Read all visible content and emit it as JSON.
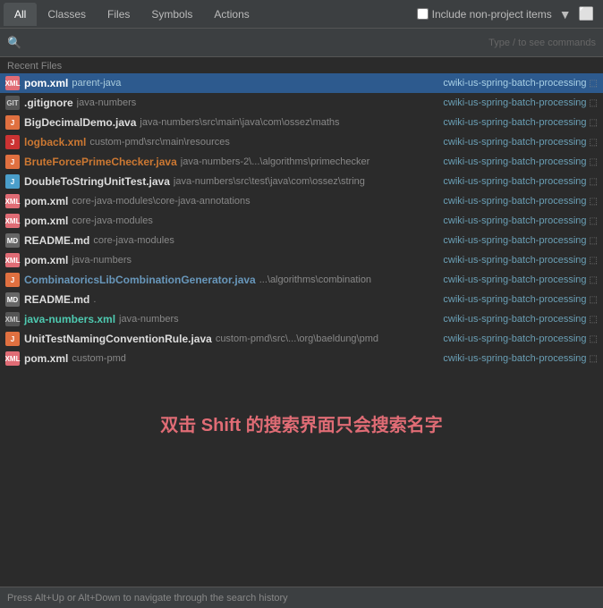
{
  "tabs": [
    {
      "id": "all",
      "label": "All",
      "active": true
    },
    {
      "id": "classes",
      "label": "Classes",
      "active": false
    },
    {
      "id": "files",
      "label": "Files",
      "active": false
    },
    {
      "id": "symbols",
      "label": "Symbols",
      "active": false
    },
    {
      "id": "actions",
      "label": "Actions",
      "active": false
    }
  ],
  "header": {
    "checkbox_label": "Include non-project items",
    "filter_icon": "☰",
    "layout_icon": "⬜"
  },
  "search": {
    "placeholder": "",
    "hint": "Type / to see commands"
  },
  "section_label": "Recent Files",
  "files": [
    {
      "icon_type": "xml",
      "icon_text": "XML",
      "name": "pom.xml",
      "name_color": "selected-white",
      "extra": "parent-java",
      "extra_color": "white",
      "path": "",
      "project": "cwiki-us-spring-batch-processing",
      "selected": true
    },
    {
      "icon_type": "gitignore",
      "icon_text": "GIT",
      "name": ".gitignore",
      "name_color": "white",
      "extra": "java-numbers",
      "extra_color": "",
      "path": "",
      "project": "cwiki-us-spring-batch-processing",
      "selected": false
    },
    {
      "icon_type": "java-orange",
      "icon_text": "J",
      "name": "BigDecimalDemo.java",
      "name_color": "white",
      "extra": "",
      "extra_color": "",
      "path": "java-numbers\\src\\main\\java\\com\\ossez\\maths",
      "project": "cwiki-us-spring-batch-processing",
      "selected": false
    },
    {
      "icon_type": "java-red",
      "icon_text": "J",
      "name": "logback.xml",
      "name_color": "orange",
      "extra": "",
      "extra_color": "",
      "path": "custom-pmd\\src\\main\\resources",
      "project": "cwiki-us-spring-batch-processing",
      "selected": false
    },
    {
      "icon_type": "java-orange",
      "icon_text": "J",
      "name": "BruteForcePrimeChecker.java",
      "name_color": "orange",
      "extra": "",
      "extra_color": "",
      "path": "java-numbers-2\\...\\algorithms\\primechecker",
      "project": "cwiki-us-spring-batch-processing",
      "selected": false
    },
    {
      "icon_type": "java-blue",
      "icon_text": "J",
      "name": "DoubleToStringUnitTest.java",
      "name_color": "white",
      "extra": "",
      "extra_color": "",
      "path": "java-numbers\\src\\test\\java\\com\\ossez\\string",
      "project": "cwiki-us-spring-batch-processing",
      "selected": false
    },
    {
      "icon_type": "xml",
      "icon_text": "XML",
      "name": "pom.xml",
      "name_color": "white",
      "extra": "",
      "extra_color": "",
      "path": "core-java-modules\\core-java-annotations",
      "project": "cwiki-us-spring-batch-processing",
      "selected": false
    },
    {
      "icon_type": "xml",
      "icon_text": "XML",
      "name": "pom.xml",
      "name_color": "white",
      "extra": "",
      "extra_color": "",
      "path": "core-java-modules",
      "project": "cwiki-us-spring-batch-processing",
      "selected": false
    },
    {
      "icon_type": "md",
      "icon_text": "MD",
      "name": "README.md",
      "name_color": "white",
      "extra": "",
      "extra_color": "",
      "path": "core-java-modules",
      "project": "cwiki-us-spring-batch-processing",
      "selected": false
    },
    {
      "icon_type": "xml",
      "icon_text": "XML",
      "name": "pom.xml",
      "name_color": "white",
      "extra": "",
      "extra_color": "",
      "path": "java-numbers",
      "project": "cwiki-us-spring-batch-processing",
      "selected": false
    },
    {
      "icon_type": "java-orange",
      "icon_text": "J",
      "name": "CombinatoricsLibCombinationGenerator.java",
      "name_color": "blue",
      "extra": "",
      "extra_color": "",
      "path": "...\\algorithms\\combination",
      "project": "cwiki-us-spring-batch-processing",
      "selected": false
    },
    {
      "icon_type": "md",
      "icon_text": "MD",
      "name": "README.md",
      "name_color": "white",
      "extra": ".",
      "extra_color": "",
      "path": "",
      "project": "cwiki-us-spring-batch-processing",
      "selected": false
    },
    {
      "icon_type": "gitignore",
      "icon_text": "XML",
      "name": "java-numbers.xml",
      "name_color": "cyan",
      "extra": "",
      "extra_color": "",
      "path": "java-numbers",
      "project": "cwiki-us-spring-batch-processing",
      "selected": false
    },
    {
      "icon_type": "java-orange",
      "icon_text": "J",
      "name": "UnitTestNamingConventionRule.java",
      "name_color": "white",
      "extra": "",
      "extra_color": "",
      "path": "custom-pmd\\src\\...\\org\\baeldung\\pmd",
      "project": "cwiki-us-spring-batch-processing",
      "selected": false
    },
    {
      "icon_type": "xml",
      "icon_text": "XML",
      "name": "pom.xml",
      "name_color": "white",
      "extra": "",
      "extra_color": "",
      "path": "custom-pmd",
      "project": "cwiki-us-spring-batch-processing",
      "selected": false
    }
  ],
  "annotation": {
    "text": "双击 Shift 的搜索界面只会搜索名字"
  },
  "bottom": {
    "hint": "Press Alt+Up or Alt+Down to navigate through the search history"
  }
}
